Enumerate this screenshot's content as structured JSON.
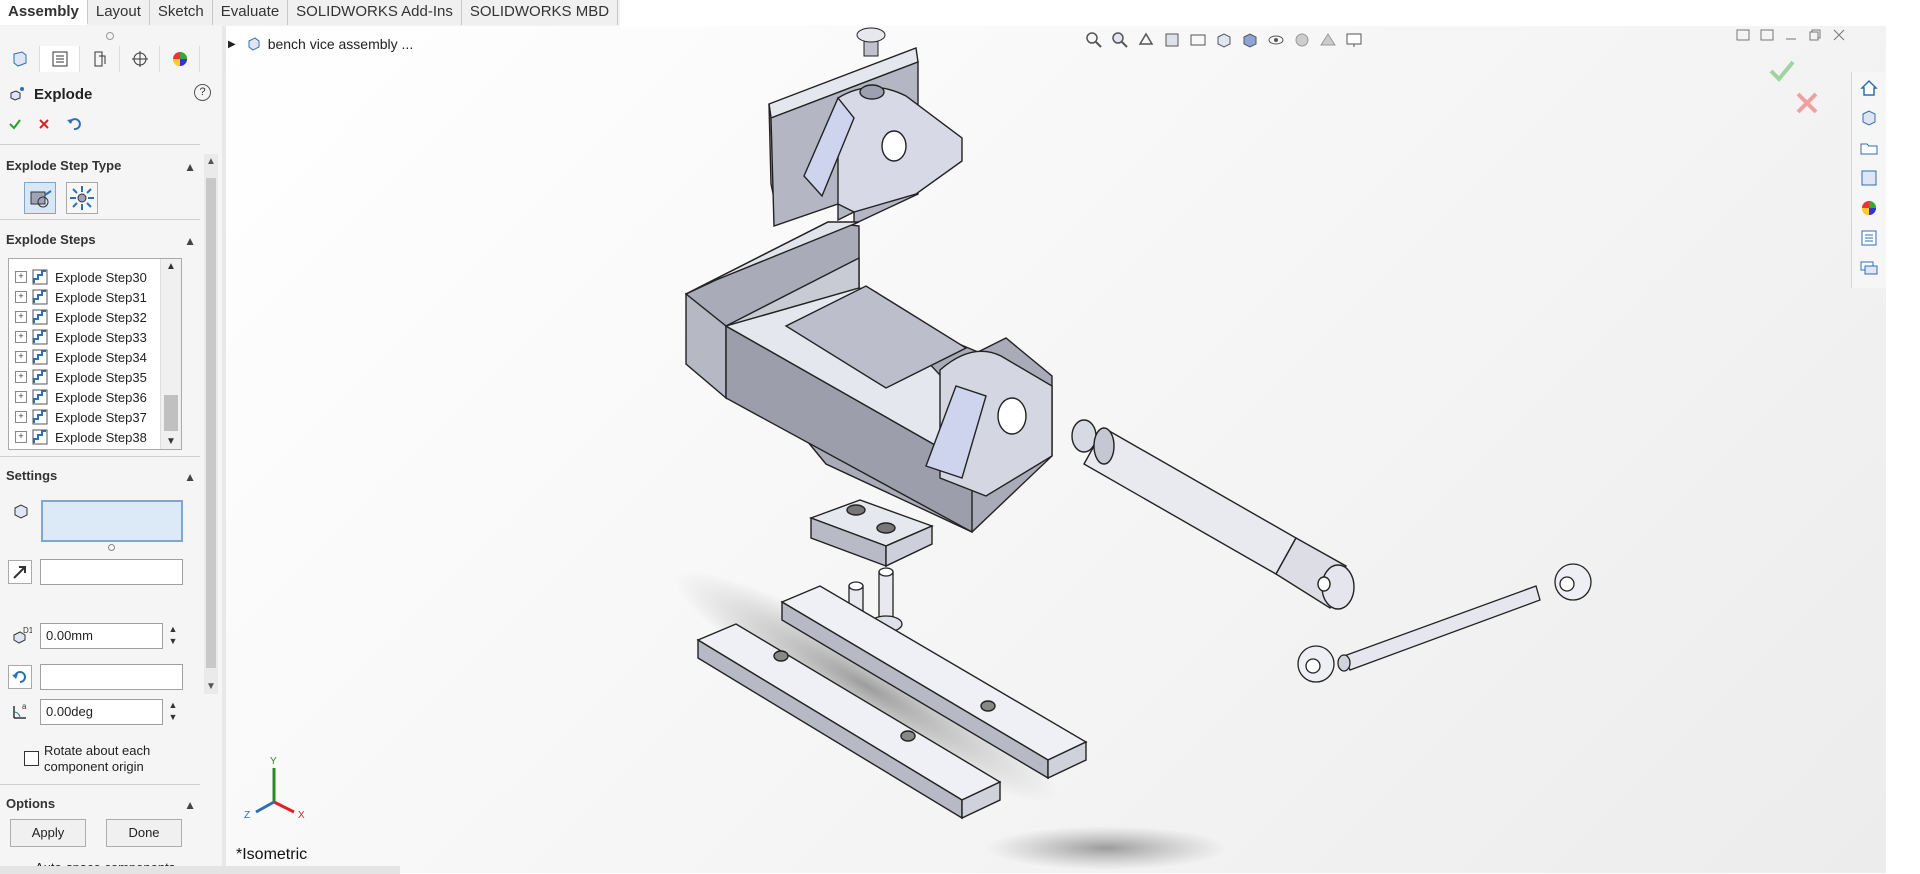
{
  "ribbon": {
    "tabs": [
      "Assembly",
      "Layout",
      "Sketch",
      "Evaluate",
      "SOLIDWORKS Add-Ins",
      "SOLIDWORKS MBD"
    ],
    "active_tab": "Assembly"
  },
  "property_manager": {
    "title": "Explode",
    "help_icon": "question-icon",
    "ok_icon": "check-icon",
    "cancel_icon": "close-icon",
    "undo_icon": "undo-icon",
    "step_type": {
      "heading": "Explode Step Type",
      "options": [
        "regular-step-icon",
        "radial-step-icon"
      ]
    },
    "steps": {
      "heading": "Explode Steps",
      "items": [
        "Explode Step30",
        "Explode Step31",
        "Explode Step32",
        "Explode Step33",
        "Explode Step34",
        "Explode Step35",
        "Explode Step36",
        "Explode Step37",
        "Explode Step38"
      ]
    },
    "settings": {
      "heading": "Settings",
      "components_value": "",
      "direction_value": "",
      "distance_value": "0.00mm",
      "rotation_axis_value": "",
      "angle_value": "0.00deg",
      "rotate_label": "Rotate about each component origin",
      "rotate_checked": false
    },
    "options": {
      "heading": "Options",
      "apply_label": "Apply",
      "done_label": "Done",
      "autospace_label": "Auto-space components on drag",
      "autospace_checked": false
    }
  },
  "viewport": {
    "tree_root": "bench vice assembly ...",
    "view_name": "*Isometric",
    "triad": {
      "x": "X",
      "y": "Y",
      "z": "Z"
    }
  },
  "colors": {
    "accent_blue": "#2d6fb5",
    "ok_green": "#2aa02a",
    "cancel_red": "#d22",
    "part_fill": "#c9cbd6",
    "part_top": "#e4e6ef",
    "part_side": "#a7a9b8"
  }
}
